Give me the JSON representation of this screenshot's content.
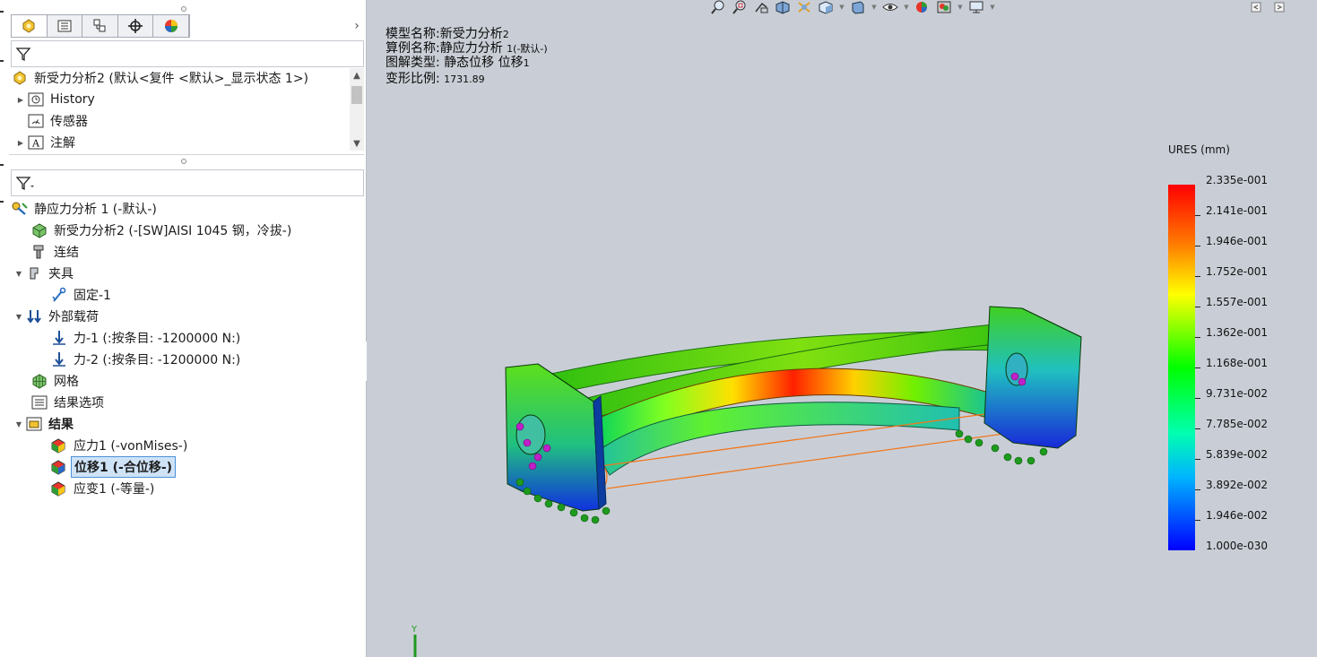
{
  "property_manager": {
    "tabs": [
      {
        "icon": "feature-manager-icon",
        "active": true
      },
      {
        "icon": "property-manager-icon",
        "active": false
      },
      {
        "icon": "configuration-manager-icon",
        "active": false
      },
      {
        "icon": "dimxpert-icon",
        "active": false
      },
      {
        "icon": "display-manager-icon",
        "active": false
      }
    ],
    "more": "›"
  },
  "feature_tree": {
    "root": "新受力分析2 (默认<复件 <默认>_显示状态 1>)",
    "items": [
      {
        "label": "History",
        "icon": "history-icon"
      },
      {
        "label": "传感器",
        "icon": "sensor-icon"
      },
      {
        "label": "注解",
        "icon": "annotation-icon"
      }
    ]
  },
  "sim_tree": {
    "study": "静应力分析 1 (-默认-)",
    "part": "新受力分析2 (-[SW]AISI 1045 钢，冷拔-)",
    "connections": "连结",
    "fixtures": "夹具",
    "fixed": "固定-1",
    "external_loads": "外部载荷",
    "force1": "力-1 (:按条目: -1200000 N:)",
    "force2": "力-2 (:按条目: -1200000 N:)",
    "mesh": "网格",
    "result_options": "结果选项",
    "results": "结果",
    "stress": "应力1 (-vonMises-)",
    "displacement": "位移1 (-合位移-)",
    "strain": "应变1 (-等量-)"
  },
  "hud": {
    "model_name": "模型名称:新受力分析",
    "model_name_suffix": "2",
    "study_name": "算例名称:静应力分析",
    "study_name_suffix": "1(-默认-)",
    "plot_type": "图解类型: 静态位移 位移",
    "plot_type_suffix": "1",
    "deform_scale": "变形比例:",
    "deform_scale_value": "1731.89"
  },
  "legend": {
    "title": "URES (mm)",
    "values": [
      "2.335e-001",
      "2.141e-001",
      "1.946e-001",
      "1.752e-001",
      "1.557e-001",
      "1.362e-001",
      "1.168e-001",
      "9.731e-002",
      "7.785e-002",
      "5.839e-002",
      "3.892e-002",
      "1.946e-002",
      "1.000e-030"
    ],
    "colors": {
      "max": "#ff0000",
      "mid": "#00ff00",
      "min": "#0000ff"
    }
  },
  "axis_triad": {
    "label": "Y"
  },
  "colors": {
    "selection_bg": "#cfe3f7",
    "selection_border": "#4c91d9",
    "viewport_bg": "#c9ced6"
  }
}
